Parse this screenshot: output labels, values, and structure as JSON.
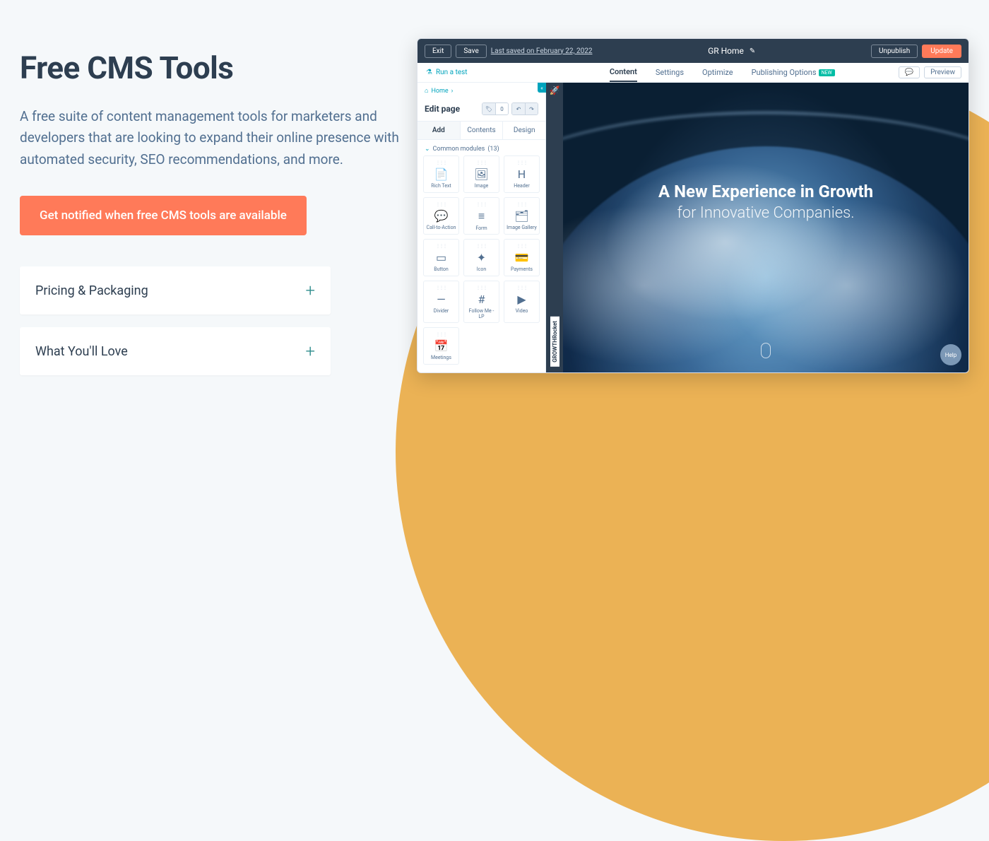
{
  "left": {
    "heading": "Free CMS Tools",
    "description": "A free suite of content management tools for marketers and developers that are looking to expand their online presence with automated security, SEO recommendations, and more.",
    "cta": "Get notified when free CMS tools are available",
    "accordions": [
      {
        "title": "Pricing & Packaging"
      },
      {
        "title": "What You'll Love"
      }
    ]
  },
  "screenshot": {
    "topbar": {
      "exit": "Exit",
      "save": "Save",
      "last_saved": "Last saved on February 22, 2022",
      "page_title": "GR Home",
      "unpublish": "Unpublish",
      "update": "Update"
    },
    "test_link": "Run a test",
    "tabs": [
      "Content",
      "Settings",
      "Optimize",
      "Publishing Options"
    ],
    "tabs_active_index": 0,
    "new_badge": "NEW",
    "preview_btn": "Preview",
    "breadcrumb": "Home",
    "edit_title": "Edit page",
    "counter": "0",
    "sidebar_tabs": [
      "Add",
      "Contents",
      "Design"
    ],
    "sidebar_tabs_active_index": 0,
    "section_header": "Common modules",
    "section_count": "(13)",
    "modules": [
      {
        "label": "Rich Text",
        "icon": "📄"
      },
      {
        "label": "Image",
        "icon": "🖼"
      },
      {
        "label": "Header",
        "icon": "H"
      },
      {
        "label": "Call-to-Action",
        "icon": "💬"
      },
      {
        "label": "Form",
        "icon": "≡"
      },
      {
        "label": "Image Gallery",
        "icon": "🗂"
      },
      {
        "label": "Button",
        "icon": "▭"
      },
      {
        "label": "Icon",
        "icon": "✦"
      },
      {
        "label": "Payments",
        "icon": "💳"
      },
      {
        "label": "Divider",
        "icon": "—"
      },
      {
        "label": "Follow Me - LP",
        "icon": "#"
      },
      {
        "label": "Video",
        "icon": "▶"
      },
      {
        "label": "Meetings",
        "icon": "📅"
      }
    ],
    "brand_strip": "GROWTHRocket",
    "hero_h": "A New Experience in Growth",
    "hero_sub": "for Innovative Companies.",
    "help": "Help"
  }
}
